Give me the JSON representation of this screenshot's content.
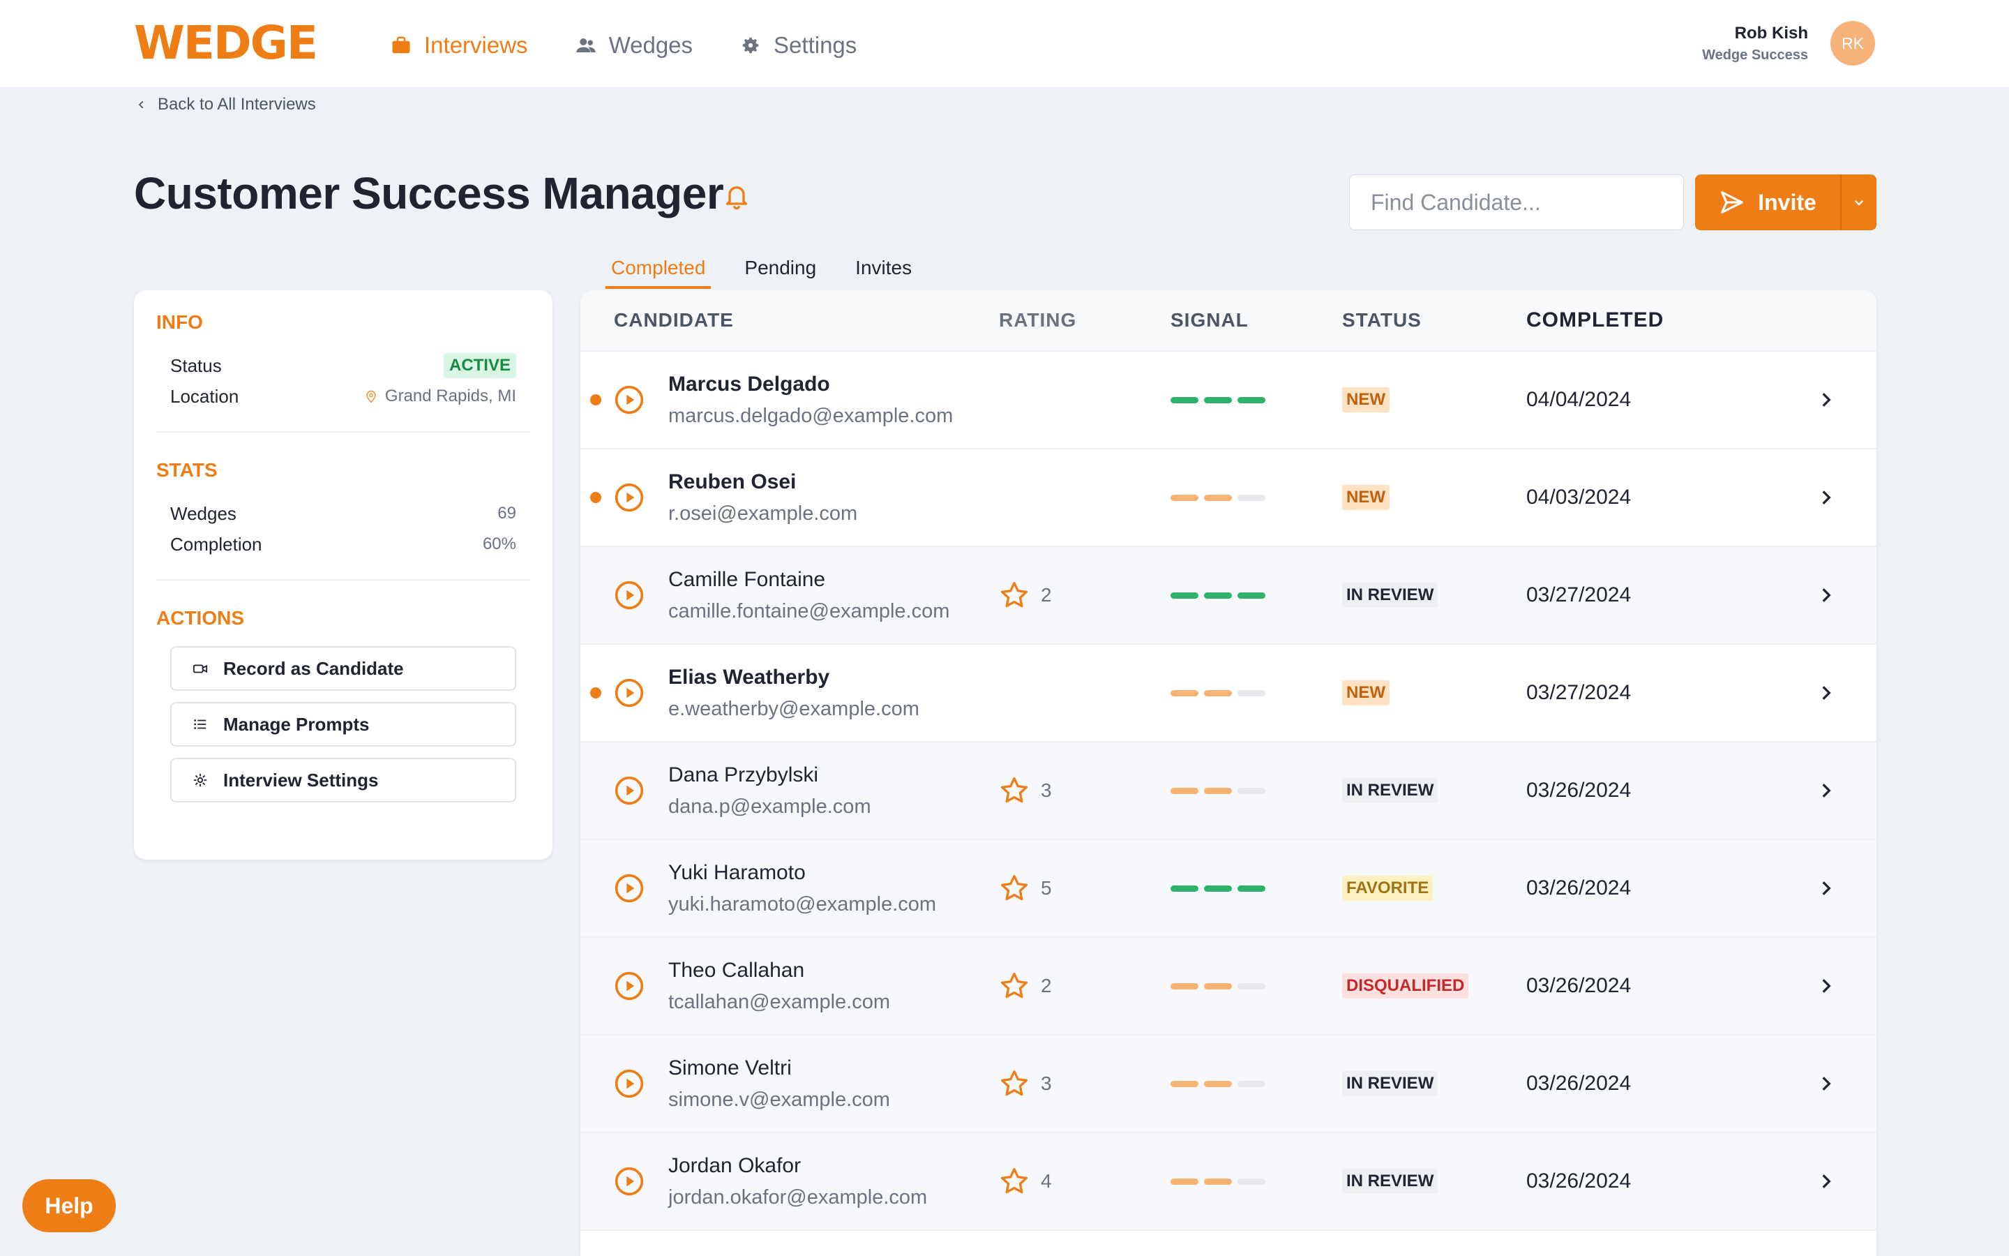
{
  "app": {
    "logo": "WEDGE"
  },
  "nav": [
    {
      "label": "Interviews",
      "icon": "briefcase-icon",
      "active": true
    },
    {
      "label": "Wedges",
      "icon": "users-icon",
      "active": false
    },
    {
      "label": "Settings",
      "icon": "gear-icon",
      "active": false
    }
  ],
  "user": {
    "name": "Rob Kish",
    "role": "Wedge Success",
    "initials": "RK"
  },
  "back_link": "Back to All Interviews",
  "page": {
    "title": "Customer Success Manager"
  },
  "search": {
    "placeholder": "Find Candidate..."
  },
  "invite": {
    "label": "Invite"
  },
  "tabs": [
    "Completed",
    "Pending",
    "Invites"
  ],
  "info": {
    "title": "INFO",
    "status_label": "Status",
    "status_value": "ACTIVE",
    "location_label": "Location",
    "location_value": "Grand Rapids, MI"
  },
  "stats": {
    "title": "STATS",
    "wedges_label": "Wedges",
    "wedges_value": "69",
    "completion_label": "Completion",
    "completion_value": "60%"
  },
  "actions": {
    "title": "ACTIONS",
    "record": "Record as Candidate",
    "prompts": "Manage Prompts",
    "settings": "Interview Settings"
  },
  "table": {
    "headers": {
      "candidate": "CANDIDATE",
      "rating": "RATING",
      "signal": "SIGNAL",
      "status": "STATUS",
      "completed": "COMPLETED"
    },
    "rows": [
      {
        "name": "Marcus Delgado",
        "email": "marcus.delgado@example.com",
        "rating": "",
        "signal": "green",
        "status": "NEW",
        "status_type": "new",
        "date": "04/04/2024",
        "unread": true
      },
      {
        "name": "Reuben Osei",
        "email": "r.osei@example.com",
        "rating": "",
        "signal": "orange",
        "status": "NEW",
        "status_type": "new",
        "date": "04/03/2024",
        "unread": true
      },
      {
        "name": "Camille Fontaine",
        "email": "camille.fontaine@example.com",
        "rating": "2",
        "signal": "green",
        "status": "IN REVIEW",
        "status_type": "review",
        "date": "03/27/2024",
        "unread": false
      },
      {
        "name": "Elias Weatherby",
        "email": "e.weatherby@example.com",
        "rating": "",
        "signal": "orange",
        "status": "NEW",
        "status_type": "new",
        "date": "03/27/2024",
        "unread": true
      },
      {
        "name": "Dana Przybylski",
        "email": "dana.p@example.com",
        "rating": "3",
        "signal": "orange",
        "status": "IN REVIEW",
        "status_type": "review",
        "date": "03/26/2024",
        "unread": false
      },
      {
        "name": "Yuki Haramoto",
        "email": "yuki.haramoto@example.com",
        "rating": "5",
        "signal": "green",
        "status": "FAVORITE",
        "status_type": "fav",
        "date": "03/26/2024",
        "unread": false
      },
      {
        "name": "Theo Callahan",
        "email": "tcallahan@example.com",
        "rating": "2",
        "signal": "orange",
        "status": "DISQUALIFIED",
        "status_type": "dq",
        "date": "03/26/2024",
        "unread": false
      },
      {
        "name": "Simone Veltri",
        "email": "simone.v@example.com",
        "rating": "3",
        "signal": "orange",
        "status": "IN REVIEW",
        "status_type": "review",
        "date": "03/26/2024",
        "unread": false
      },
      {
        "name": "Jordan Okafor",
        "email": "jordan.okafor@example.com",
        "rating": "4",
        "signal": "orange",
        "status": "IN REVIEW",
        "status_type": "review",
        "date": "03/26/2024",
        "unread": false
      }
    ]
  },
  "help": {
    "label": "Help"
  },
  "colors": {
    "accent": "#ef7d15",
    "signal_green": "#2fb169",
    "signal_orange": "#f7b373"
  }
}
